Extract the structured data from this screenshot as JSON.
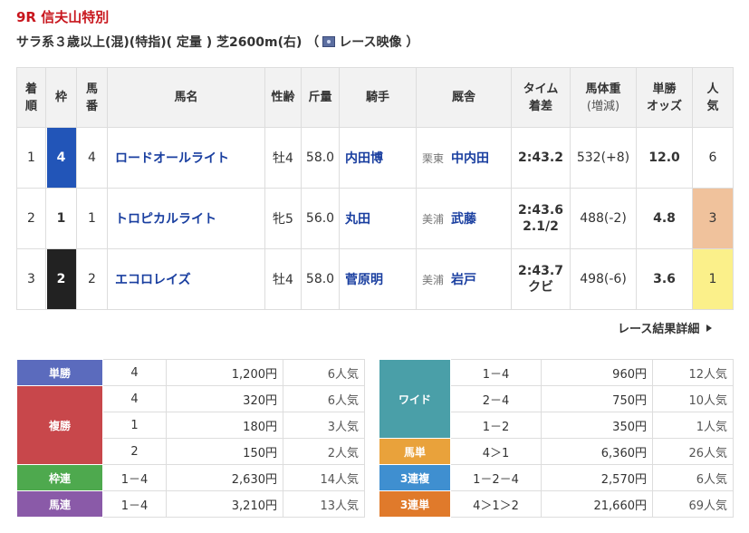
{
  "race": {
    "title": "9R 信夫山特別",
    "cond_before": "サラ系３歳以上(混)(特指)( 定量 ) 芝2600m(右) （",
    "video_label": "レース映像 ）"
  },
  "result_headers": {
    "rank": [
      "着",
      "順"
    ],
    "waku": "枠",
    "horse_no": [
      "馬",
      "番"
    ],
    "name": "馬名",
    "sex_age": "性齢",
    "weight": "斤量",
    "jockey": "騎手",
    "stable": "厩舎",
    "time": [
      "タイム",
      "着差"
    ],
    "body": [
      "馬体重",
      "(増減)"
    ],
    "odds": [
      "単勝",
      "オッズ"
    ],
    "pop": [
      "人",
      "気"
    ]
  },
  "results": [
    {
      "rank": "1",
      "waku": "4",
      "no": "4",
      "name": "ロードオールライト",
      "sex_age": "牡4",
      "weight": "58.0",
      "jockey": "内田博",
      "region": "栗東",
      "trainer": "中内田",
      "time": "2:43.2",
      "margin": "",
      "body": "532(+8)",
      "odds": "12.0",
      "pop": "6"
    },
    {
      "rank": "2",
      "waku": "1",
      "no": "1",
      "name": "トロピカルライト",
      "sex_age": "牝5",
      "weight": "56.0",
      "jockey": "丸田",
      "region": "美浦",
      "trainer": "武藤",
      "time": "2:43.6",
      "margin": "2.1/2",
      "body": "488(-2)",
      "odds": "4.8",
      "pop": "3"
    },
    {
      "rank": "3",
      "waku": "2",
      "no": "2",
      "name": "エコロレイズ",
      "sex_age": "牡4",
      "weight": "58.0",
      "jockey": "菅原明",
      "region": "美浦",
      "trainer": "岩戸",
      "time": "2:43.7",
      "margin": "クビ",
      "body": "498(-6)",
      "odds": "3.6",
      "pop": "1"
    }
  ],
  "detail_link": "レース結果詳細",
  "payout_left": {
    "tansho": {
      "label": "単勝",
      "color": "#5b6bbd",
      "rows": [
        {
          "combo": "4",
          "amount": "1,200円",
          "pop": "6人気"
        }
      ]
    },
    "fukusho": {
      "label": "複勝",
      "color": "#c8474b",
      "rows": [
        {
          "combo": "4",
          "amount": "320円",
          "pop": "6人気"
        },
        {
          "combo": "1",
          "amount": "180円",
          "pop": "3人気"
        },
        {
          "combo": "2",
          "amount": "150円",
          "pop": "2人気"
        }
      ]
    },
    "wakuren": {
      "label": "枠連",
      "color": "#4ea94e",
      "rows": [
        {
          "combo": "1－4",
          "amount": "2,630円",
          "pop": "14人気"
        }
      ]
    },
    "umaren": {
      "label": "馬連",
      "color": "#8a5aa8",
      "rows": [
        {
          "combo": "1－4",
          "amount": "3,210円",
          "pop": "13人気"
        }
      ]
    }
  },
  "payout_right": {
    "wide": {
      "label": "ワイド",
      "color": "#4a9fa8",
      "rows": [
        {
          "combo": "1－4",
          "amount": "960円",
          "pop": "12人気"
        },
        {
          "combo": "2－4",
          "amount": "750円",
          "pop": "10人気"
        },
        {
          "combo": "1－2",
          "amount": "350円",
          "pop": "1人気"
        }
      ]
    },
    "umatan": {
      "label": "馬単",
      "color": "#e9a23b",
      "rows": [
        {
          "combo": "4＞1",
          "amount": "6,360円",
          "pop": "26人気"
        }
      ]
    },
    "sanrenpuku": {
      "label": "3連複",
      "color": "#3f8fd0",
      "rows": [
        {
          "combo": "1－2－4",
          "amount": "2,570円",
          "pop": "6人気"
        }
      ]
    },
    "sanrentan": {
      "label": "3連単",
      "color": "#e07a2b",
      "rows": [
        {
          "combo": "4＞1＞2",
          "amount": "21,660円",
          "pop": "69人気"
        }
      ]
    }
  }
}
